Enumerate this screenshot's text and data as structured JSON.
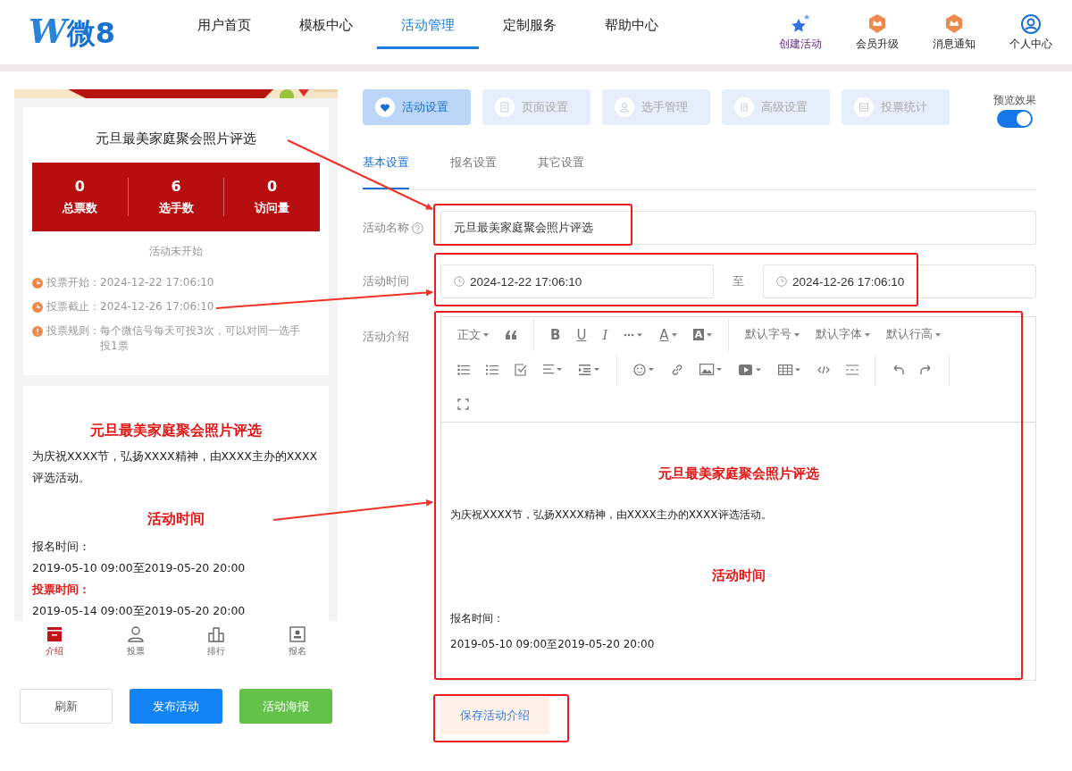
{
  "header": {
    "logo_mark": "W",
    "logo_text": "微8",
    "nav": [
      {
        "label": "用户首页",
        "selected": false
      },
      {
        "label": "模板中心",
        "selected": false
      },
      {
        "label": "活动管理",
        "selected": true
      },
      {
        "label": "定制服务",
        "selected": false
      },
      {
        "label": "帮助中心",
        "selected": false
      }
    ],
    "actions": [
      {
        "label": "创建活动",
        "kind": "create"
      },
      {
        "label": "会员升级",
        "kind": "badge"
      },
      {
        "label": "消息通知",
        "kind": "badge"
      },
      {
        "label": "个人中心",
        "kind": "user"
      }
    ]
  },
  "preview": {
    "title": "元旦最美家庭聚会照片评选",
    "stats": [
      {
        "value": "0",
        "label": "总票数"
      },
      {
        "value": "6",
        "label": "选手数"
      },
      {
        "value": "0",
        "label": "访问量"
      }
    ],
    "status": "活动未开始",
    "info": [
      {
        "kind": "time",
        "label": "投票开始：",
        "value": "2024-12-22 17:06:10"
      },
      {
        "kind": "time",
        "label": "投票截止：",
        "value": "2024-12-26 17:06:10"
      },
      {
        "kind": "rule",
        "label": "投票规则：",
        "value": "每个微信号每天可投3次，可以对同一选手投1票"
      }
    ],
    "content": [
      {
        "kind": "heading",
        "text": "元旦最美家庭聚会照片评选"
      },
      {
        "kind": "paragraph",
        "text": "为庆祝XXXX节，弘扬XXXX精神，由XXXX主办的XXXX评选活动。"
      },
      {
        "kind": "heading",
        "text": "活动时间"
      },
      {
        "kind": "paragraph",
        "text": "报名时间："
      },
      {
        "kind": "paragraph",
        "text": "2019-05-10 09:00至2019-05-20 20:00"
      },
      {
        "kind": "highlight",
        "text": "投票时间："
      },
      {
        "kind": "paragraph",
        "text": "2019-05-14 09:00至2019-05-20 20:00"
      }
    ],
    "tabbar": [
      {
        "label": "介绍",
        "selected": true
      },
      {
        "label": "投票",
        "selected": false
      },
      {
        "label": "排行",
        "selected": false
      },
      {
        "label": "报名",
        "selected": false
      }
    ],
    "buttons": [
      {
        "label": "刷新",
        "kind": "plain"
      },
      {
        "label": "发布活动",
        "kind": "primary"
      },
      {
        "label": "活动海报",
        "kind": "success"
      }
    ]
  },
  "settings": {
    "tabs": [
      {
        "label": "活动设置",
        "selected": true
      },
      {
        "label": "页面设置",
        "selected": false
      },
      {
        "label": "选手管理",
        "selected": false
      },
      {
        "label": "高级设置",
        "selected": false
      },
      {
        "label": "投票统计",
        "selected": false
      }
    ],
    "preview_toggle": {
      "label": "预览效果",
      "on": true
    },
    "subtabs": [
      {
        "label": "基本设置",
        "selected": true
      },
      {
        "label": "报名设置",
        "selected": false
      },
      {
        "label": "其它设置",
        "selected": false
      }
    ],
    "name": {
      "label": "活动名称",
      "value": "元旦最美家庭聚会照片评选"
    },
    "time": {
      "label": "活动时间",
      "start": "2024-12-22 17:06:10",
      "separator": "至",
      "end": "2024-12-26 17:06:10"
    },
    "intro": {
      "label": "活动介绍",
      "toolbar": {
        "style": "正文",
        "bold": "B",
        "underline": "U",
        "italic": "I",
        "font_color_glyph": "A",
        "highlight_glyph": "A",
        "dropdowns": [
          "默认字号",
          "默认字体",
          "默认行高"
        ]
      },
      "content": [
        {
          "kind": "heading",
          "text": "元旦最美家庭聚会照片评选"
        },
        {
          "kind": "paragraph",
          "text": "为庆祝XXXX节，弘扬XXXX精神，由XXXX主办的XXXX评选活动。"
        },
        {
          "kind": "heading",
          "text": "活动时间"
        },
        {
          "kind": "paragraph",
          "text": "报名时间："
        },
        {
          "kind": "paragraph",
          "text": "2019-05-10 09:00至2019-05-20 20:00"
        }
      ]
    },
    "save_button": "保存活动介绍"
  }
}
